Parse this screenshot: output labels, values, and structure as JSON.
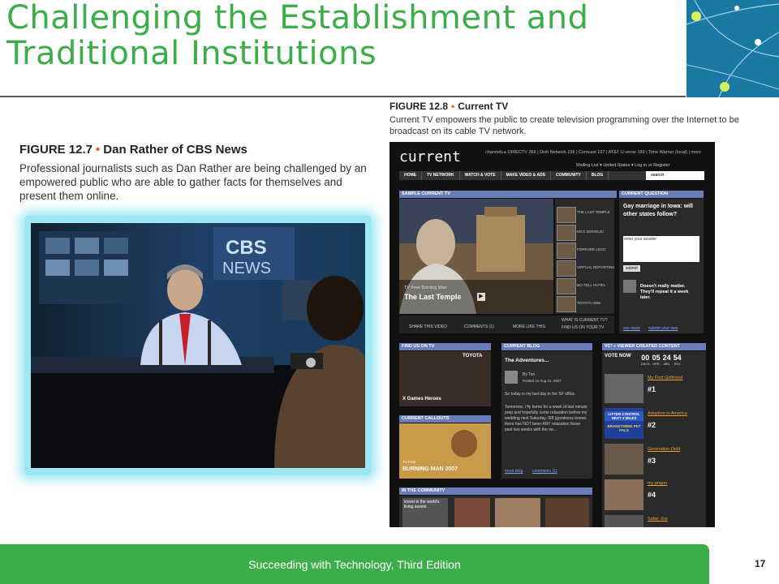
{
  "slide": {
    "title_line1": "Challenging the Establishment and",
    "title_line2": "Traditional Institutions",
    "footer": "Succeeding with Technology, Third Edition",
    "page_number": "17"
  },
  "figure_left": {
    "label": "FIGURE 12.7",
    "name": "Dan Rather of CBS News",
    "description": "Professional journalists such as Dan Rather are being challenged by an empowered public who are able to gather facts for themselves and present them online.",
    "photo_text": "CBS NEWS"
  },
  "figure_right": {
    "label": "FIGURE 12.8",
    "name": "Current TV",
    "description": "Current TV empowers the public to create television programming over the Internet to be broadcast on its cable TV network."
  },
  "site": {
    "logo": "current",
    "channels": "channels ▸ DIRECTV 366 | Dish Network 196 | Comcast 107 | AT&T U-verse 189 | Time Warner (local) | more",
    "mailing": "Mailing List  ▾   United States  ▾   Log in or Register",
    "nav": [
      "HOME",
      "TV NETWORK",
      "WATCH & VOTE",
      "MAKE VIDEO & ADS",
      "COMMUNITY",
      "BLOG"
    ],
    "search": "search",
    "sample_header": "SAMPLE CURRENT TV",
    "video_sub": "TV Free Burning Man",
    "video_title": "The Last Temple",
    "side_items": [
      "THE LAST TEMPLE",
      "HE'S SERIOUS!",
      "FOREVER LEGO",
      "VIRTUAL REPORTING",
      "NO-TELL HOTEL",
      "TOYOTA VIBE"
    ],
    "bottom_bar": [
      "SHARE THIS VIDEO",
      "COMMENTS (1)",
      "MORE LIKE THIS",
      "WHAT IS CURRENT TV?",
      "FIND US ON YOUR TV"
    ],
    "question_header": "CURRENT QUESTION",
    "question": "Gay marriage in Iowa: will other states follow?",
    "answer_placeholder": "enter your answer",
    "submit": "submit",
    "answer_quote": "Doesn't really matter. They'll repeal it a week later.",
    "see_more": "see more",
    "submit_own": "submit your own",
    "find_header": "FIND US ON TV",
    "find_sub": "X Games Heroes",
    "blog_header": "CURRENT BLOG",
    "blog_title": "The Adventures...",
    "blog_author": "By Tori",
    "blog_date": "Posted on Aug 31, 2007",
    "blog_text": "So today is my last day in the SF office.",
    "blog_text2": "Tomorrow, I fly home for a week of last minute prep and hopefully some relaxation before my wedding next Saturday, 9/8 (goodness knows there has NOT been ANY relaxation these past two weeks with the ne...",
    "more_blog": "more blog",
    "comments": "comments (1)",
    "callouts_header": "CURRENT CALLOUTS",
    "callout_sub": "TV Free",
    "callout_title": "BURNING MAN 2007",
    "community_header": "IN THE COMMUNITY",
    "community_banner": "invest in the world's living assets.",
    "vc_header": "VC² » VIEWER CREATED CONTENT",
    "vote_now": "VOTE NOW",
    "countdown": [
      {
        "n": "00",
        "u": "DAYS"
      },
      {
        "n": "05",
        "u": "HRS"
      },
      {
        "n": "24",
        "u": "MIN"
      },
      {
        "n": "54",
        "u": "SEC"
      }
    ],
    "ranking": [
      {
        "title": "My First Girlfriend",
        "rank": "#1"
      },
      {
        "title": "Adoption in America",
        "rank": "#2"
      },
      {
        "title": "Generation Debt",
        "rank": "#3"
      },
      {
        "title": "my prayer",
        "rank": "#4"
      },
      {
        "title": "Safari Joe",
        "rank": ""
      }
    ],
    "litter_sign": "LITTER CONTROL NEXT 3 MILES",
    "brandywine_sign": "BRANDYWINE PET PALS"
  }
}
